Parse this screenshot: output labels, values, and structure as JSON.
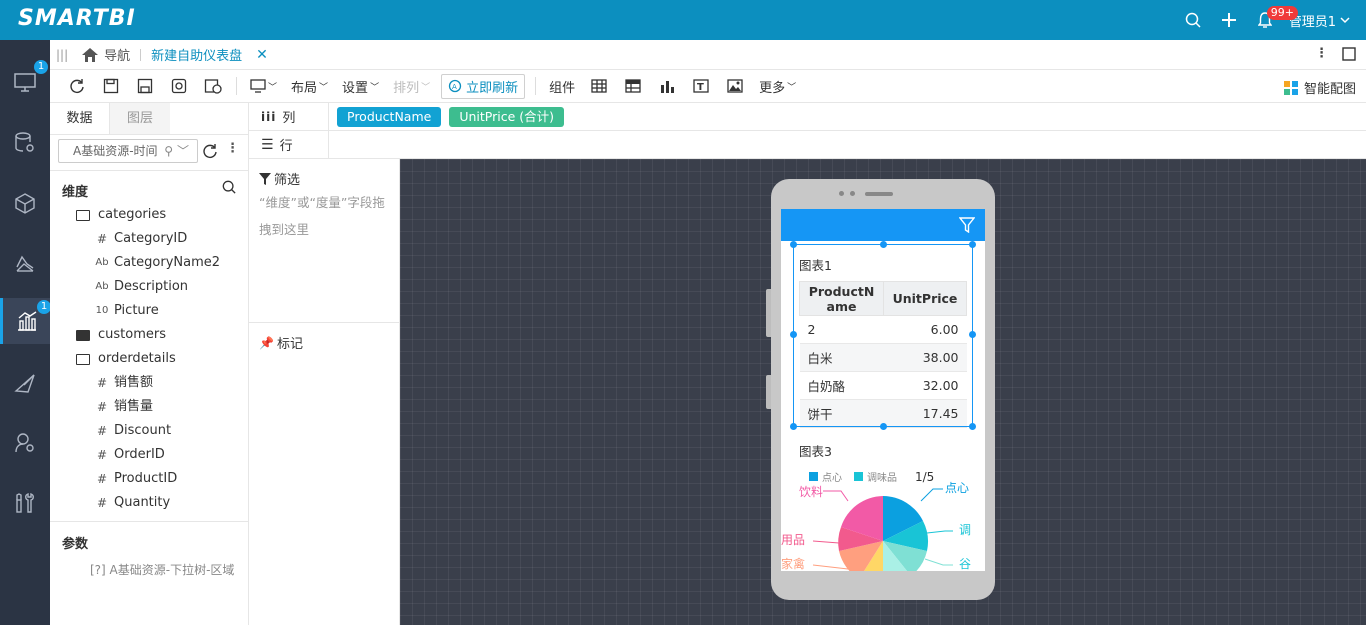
{
  "app": {
    "logo": "SMARTBI",
    "notif_badge": "99+",
    "user_label": "管理员1"
  },
  "rail": {
    "badges": [
      "1",
      "1"
    ]
  },
  "tabbar": {
    "home_label": "导航",
    "active_tab": "新建自助仪表盘"
  },
  "toolbar": {
    "layout": "布局",
    "settings": "设置",
    "arrange": "排列",
    "refresh_now": "立即刷新",
    "components": "组件",
    "more": "更多",
    "smart_config": "智能配图"
  },
  "datapanel": {
    "tabs": [
      "数据",
      "图层"
    ],
    "source_select": "A基础资源-时间",
    "dimensions_title": "维度",
    "tree": [
      {
        "type": "folder",
        "label": "categories"
      },
      {
        "type": "num",
        "label": "CategoryID"
      },
      {
        "type": "text",
        "label": "CategoryName2"
      },
      {
        "type": "text",
        "label": "Description"
      },
      {
        "type": "bin",
        "label": "Picture"
      },
      {
        "type": "folder",
        "label": "customers"
      },
      {
        "type": "folder",
        "label": "orderdetails"
      },
      {
        "type": "num",
        "label": "销售额"
      },
      {
        "type": "num",
        "label": "销售量"
      },
      {
        "type": "num",
        "label": "Discount"
      },
      {
        "type": "num",
        "label": "OrderID"
      },
      {
        "type": "num",
        "label": "ProductID"
      },
      {
        "type": "num",
        "label": "Quantity"
      }
    ],
    "params_title": "参数",
    "param_item": "[?] A基础资源-下拉树-区域"
  },
  "shelves": {
    "col_label": "列",
    "row_label": "行",
    "col_chips": [
      "ProductName",
      "UnitPrice (合计)"
    ]
  },
  "filter": {
    "title": "筛选",
    "hint": "“维度”或“度量”字段拖拽到这里",
    "mark_title": "标记"
  },
  "phone": {
    "chart1": {
      "title": "图表1",
      "headers": [
        "ProductName",
        "UnitPrice"
      ],
      "rows": [
        [
          "2",
          "6.00"
        ],
        [
          "白米",
          "38.00"
        ],
        [
          "白奶酪",
          "32.00"
        ],
        [
          "饼干",
          "17.45"
        ]
      ]
    },
    "chart3": {
      "title": "图表3",
      "legend": [
        "点心",
        "调味品"
      ],
      "pager": "1/5",
      "labels_left": [
        "饮料",
        "日用品",
        "家禽"
      ],
      "labels_right": [
        "点心",
        "调",
        "谷"
      ]
    }
  },
  "colors": {
    "header": "#0c8fbf",
    "rail": "#2b3444",
    "chip_blue": "#12a2d3",
    "chip_green": "#3dbd8f",
    "phone_head": "#1596f5"
  }
}
